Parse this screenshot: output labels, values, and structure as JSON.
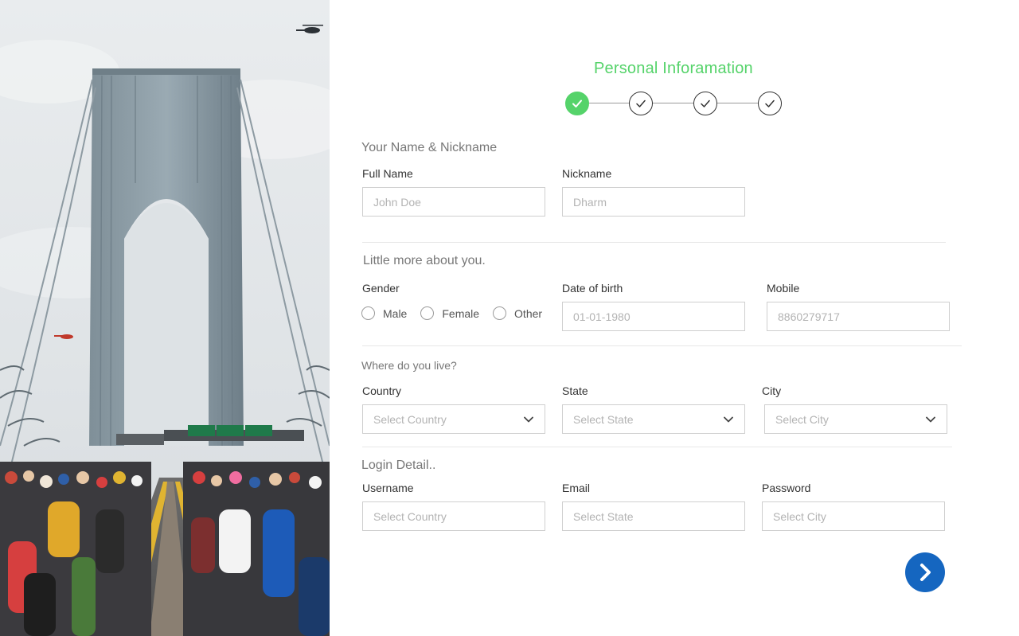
{
  "stepper": {
    "title": "Personal Inforamation",
    "steps": [
      {
        "state": "done"
      },
      {
        "state": "pending"
      },
      {
        "state": "pending"
      },
      {
        "state": "pending"
      }
    ],
    "colors": {
      "done": "#55d36a",
      "pending": "#333333"
    }
  },
  "name_section": {
    "title": "Your Name & Nickname",
    "full_name": {
      "label": "Full Name",
      "placeholder": "John Doe",
      "value": ""
    },
    "nickname": {
      "label": "Nickname",
      "placeholder": "Dharm",
      "value": ""
    }
  },
  "about_section": {
    "title": "Little more about you.",
    "gender": {
      "label": "Gender",
      "options": [
        "Male",
        "Female",
        "Other"
      ],
      "selected": null
    },
    "dob": {
      "label": "Date of birth",
      "placeholder": "01-01-1980",
      "value": ""
    },
    "mobile": {
      "label": "Mobile",
      "placeholder": "8860279717",
      "value": ""
    }
  },
  "location_section": {
    "title": "Where do you live?",
    "country": {
      "label": "Country",
      "placeholder": "Select Country"
    },
    "state": {
      "label": "State",
      "placeholder": "Select State"
    },
    "city": {
      "label": "City",
      "placeholder": "Select City"
    }
  },
  "login_section": {
    "title": "Login Detail..",
    "username": {
      "label": "Username",
      "placeholder": "Select Country",
      "value": ""
    },
    "email": {
      "label": "Email",
      "placeholder": "Select State",
      "value": ""
    },
    "password": {
      "label": "Password",
      "placeholder": "Select City",
      "value": ""
    }
  },
  "next_button": {
    "icon": "chevron-right-icon",
    "color": "#1566c0"
  },
  "hero": {
    "image": "bridge-marathon-photo"
  }
}
